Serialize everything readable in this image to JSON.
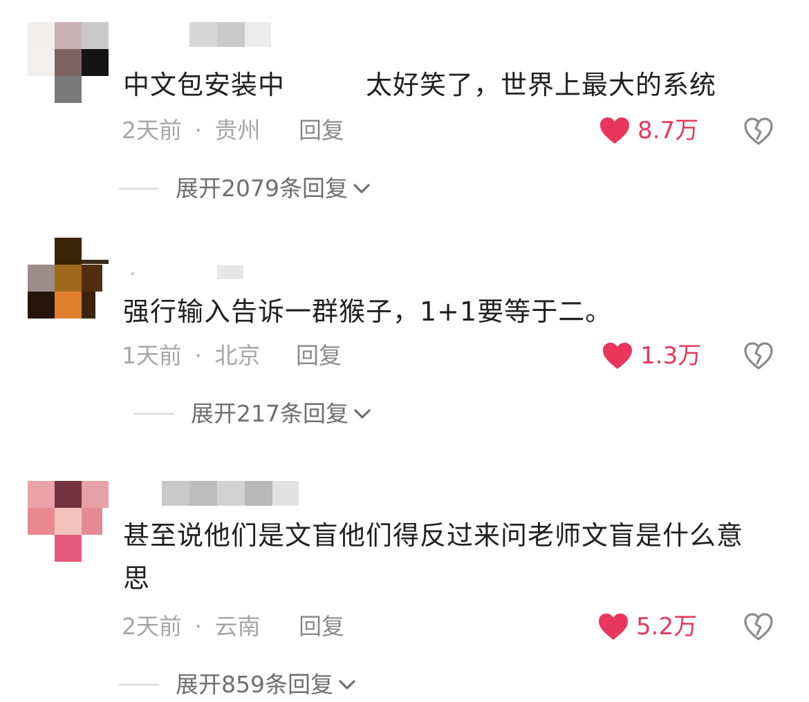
{
  "comments": [
    {
      "text": "中文包安装中　　　太好笑了，世界上最大的系统",
      "time": "2天前",
      "separator": "·",
      "location": "贵州",
      "reply_label": "回复",
      "like_count": "8.7万",
      "expand_label": "展开2079条回复"
    },
    {
      "text": "强行输入告诉一群猴子，1+1要等于二。",
      "time": "1天前",
      "separator": "·",
      "location": "北京",
      "reply_label": "回复",
      "like_count": "1.3万",
      "expand_label": "展开217条回复"
    },
    {
      "text": "甚至说他们是文盲他们得反过来问老师文盲是什么意思",
      "time": "2天前",
      "separator": "·",
      "location": "云南",
      "reply_label": "回复",
      "like_count": "5.2万",
      "expand_label": "展开859条回复"
    }
  ],
  "colors": {
    "like": "#e8365c",
    "meta": "#a6a6a6",
    "text": "#1f1f1f"
  },
  "icons": {
    "like": "heart-icon",
    "dislike": "broken-heart-icon",
    "expand": "chevron-down-icon"
  }
}
